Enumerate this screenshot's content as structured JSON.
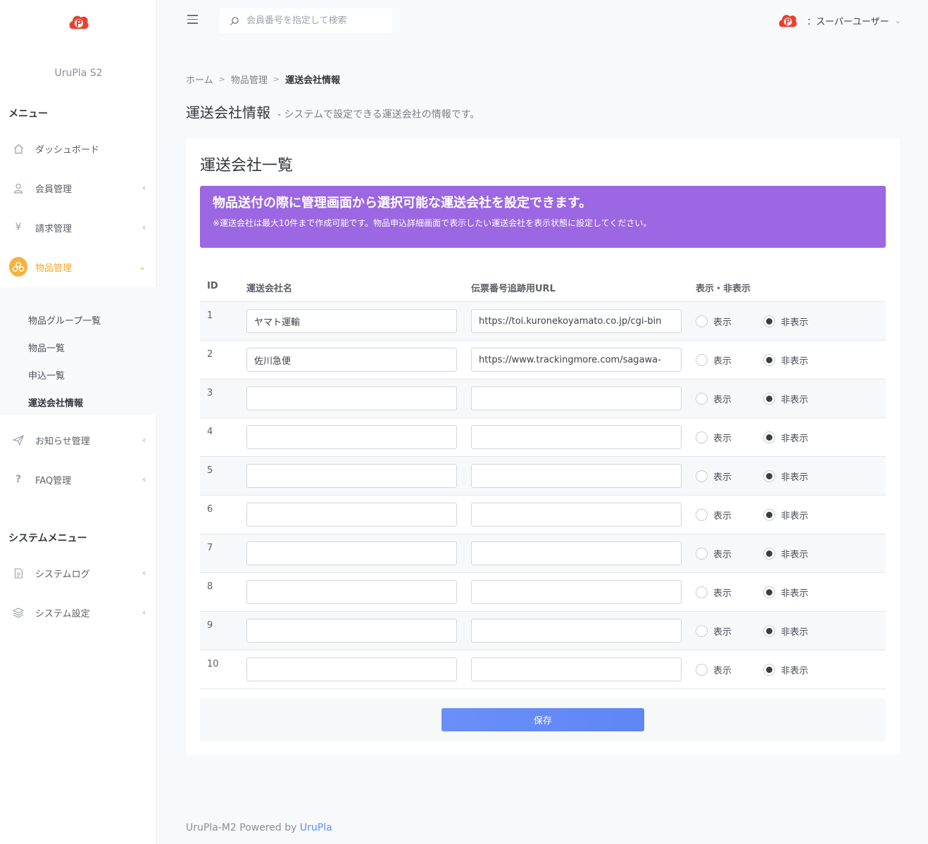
{
  "app": {
    "name": "UruPla S2",
    "brand_color": "#e8412f",
    "accent": "#f5a623"
  },
  "search": {
    "placeholder": "会員番号を指定して検索"
  },
  "user": {
    "label": "：スーパーユーザー"
  },
  "sidebar": {
    "menu_title": "メニュー",
    "items": [
      {
        "label": "ダッシュボード",
        "icon": "home-icon"
      },
      {
        "label": "会員管理",
        "icon": "user-icon",
        "chevron": "‹"
      },
      {
        "label": "請求管理",
        "icon": "yen-icon",
        "chevron": "‹"
      },
      {
        "label": "物品管理",
        "icon": "goods-icon",
        "chevron": "⌄"
      },
      {
        "label": "お知らせ管理",
        "icon": "send-icon",
        "chevron": "‹"
      },
      {
        "label": "FAQ管理",
        "icon": "question-icon",
        "chevron": "‹"
      }
    ],
    "submenu": [
      {
        "label": "物品グループ一覧"
      },
      {
        "label": "物品一覧"
      },
      {
        "label": "申込一覧"
      },
      {
        "label": "運送会社情報"
      }
    ],
    "system_title": "システムメニュー",
    "system_items": [
      {
        "label": "システムログ",
        "icon": "document-icon",
        "chevron": "‹"
      },
      {
        "label": "システム設定",
        "icon": "layers-icon",
        "chevron": "‹"
      }
    ]
  },
  "breadcrumb": {
    "home": "ホーム",
    "sep": ">",
    "parent": "物品管理",
    "current": "運送会社情報"
  },
  "page": {
    "title": "運送会社情報",
    "description": "- システムで設定できる運送会社の情報です。"
  },
  "card": {
    "title": "運送会社一覧",
    "notice_title": "物品送付の際に管理画面から選択可能な運送会社を設定できます。",
    "notice_text": "※運送会社は最大10件まで作成可能です。物品申込詳細画面で表示したい運送会社を表示状態に設定してください。"
  },
  "table": {
    "headers": {
      "id": "ID",
      "name": "運送会社名",
      "url": "伝票番号追跡用URL",
      "visibility": "表示・非表示"
    },
    "show_label": "表示",
    "hide_label": "非表示",
    "rows": [
      {
        "id": "1",
        "name": "ヤマト運輸",
        "url": "https://toi.kuronekoyamato.co.jp/cgi-bin",
        "visible": false
      },
      {
        "id": "2",
        "name": "佐川急便",
        "url": "https://www.trackingmore.com/sagawa-",
        "visible": false
      },
      {
        "id": "3",
        "name": "",
        "url": "",
        "visible": false
      },
      {
        "id": "4",
        "name": "",
        "url": "",
        "visible": false
      },
      {
        "id": "5",
        "name": "",
        "url": "",
        "visible": false
      },
      {
        "id": "6",
        "name": "",
        "url": "",
        "visible": false
      },
      {
        "id": "7",
        "name": "",
        "url": "",
        "visible": false
      },
      {
        "id": "8",
        "name": "",
        "url": "",
        "visible": false
      },
      {
        "id": "9",
        "name": "",
        "url": "",
        "visible": false
      },
      {
        "id": "10",
        "name": "",
        "url": "",
        "visible": false
      }
    ]
  },
  "buttons": {
    "save": "保存"
  },
  "footer": {
    "text": "UruPla-M2 Powered by ",
    "link": "UruPla"
  }
}
